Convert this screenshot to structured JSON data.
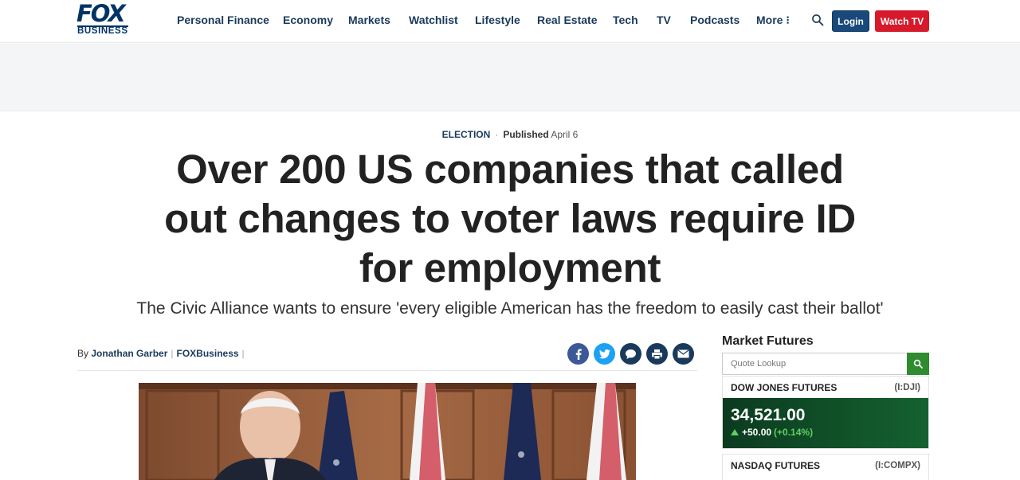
{
  "header": {
    "logo_top": "FOX",
    "logo_bottom": "BUSINESS",
    "nav": [
      {
        "label": "Personal Finance"
      },
      {
        "label": "Economy"
      },
      {
        "label": "Markets"
      },
      {
        "label": "Watchlist"
      },
      {
        "label": "Lifestyle"
      },
      {
        "label": "Real Estate"
      },
      {
        "label": "Tech"
      },
      {
        "label": "TV"
      },
      {
        "label": "Podcasts"
      },
      {
        "label": "More ⁝"
      }
    ],
    "login_label": "Login",
    "watch_label": "Watch TV"
  },
  "article": {
    "category": "ELECTION",
    "published_label": "Published",
    "published_date": "April 6",
    "headline": "Over 200 US companies that called out changes to voter laws require ID for employment",
    "dek": "The Civic Alliance wants to ensure 'every eligible American has the freedom to easily cast their ballot'",
    "byline_prefix": "By",
    "author": "Jonathan Garber",
    "outlet": "FOXBusiness"
  },
  "share_icons": [
    {
      "name": "facebook-icon"
    },
    {
      "name": "twitter-icon"
    },
    {
      "name": "comment-icon"
    },
    {
      "name": "print-icon"
    },
    {
      "name": "email-icon"
    }
  ],
  "sidebar": {
    "title": "Market Futures",
    "quote_placeholder": "Quote Lookup",
    "tickers": [
      {
        "name": "DOW JONES FUTURES",
        "symbol": "(I:DJI)",
        "price": "34,521.00",
        "change": "+50.00",
        "percent": "(+0.14%)"
      },
      {
        "name": "NASDAQ FUTURES",
        "symbol": "(I:COMPX)"
      }
    ]
  },
  "colors": {
    "brand_navy": "#003366",
    "nav_text": "#1a3a5c",
    "login_blue": "#19487b",
    "watch_red": "#d6192b",
    "quote_green": "#2e8b2e",
    "ticker_up_green": "#5ed05e"
  }
}
